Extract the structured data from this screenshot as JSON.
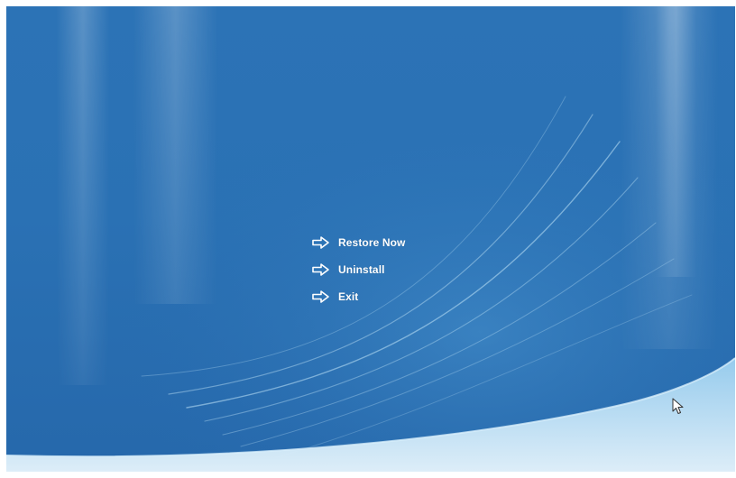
{
  "menu": {
    "items": [
      {
        "label": "Restore Now",
        "icon": "arrow-right-outline-icon"
      },
      {
        "label": "Uninstall",
        "icon": "arrow-right-outline-icon"
      },
      {
        "label": "Exit",
        "icon": "arrow-right-outline-icon"
      }
    ]
  },
  "colors": {
    "background": "#2a71b4",
    "text": "#ffffff",
    "swoosh": "#bfe3f7"
  }
}
